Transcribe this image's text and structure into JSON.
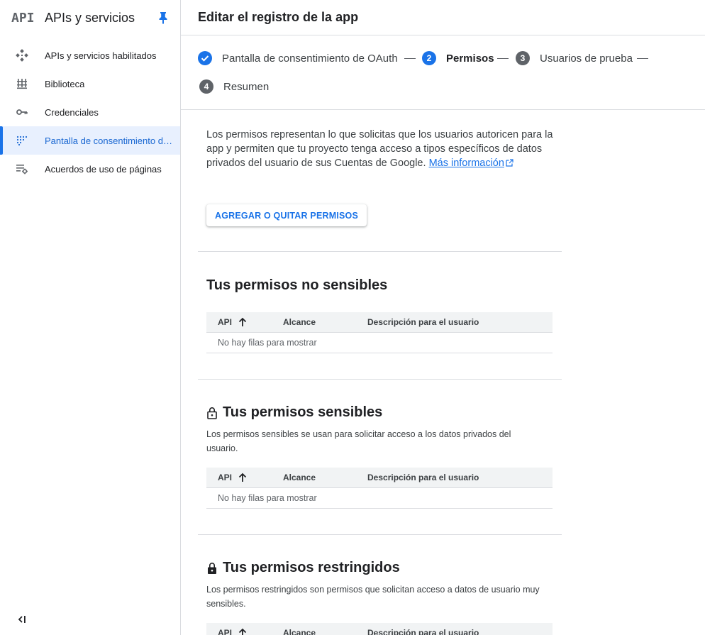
{
  "sidebar": {
    "logo": "API",
    "title": "APIs y servicios",
    "items": [
      {
        "label": "APIs y servicios habilitados",
        "icon": "diamond-nodes-icon"
      },
      {
        "label": "Biblioteca",
        "icon": "library-icon"
      },
      {
        "label": "Credenciales",
        "icon": "key-icon"
      },
      {
        "label": "Pantalla de consentimiento de OAuth",
        "icon": "dots-grid-icon",
        "active": true
      },
      {
        "label": "Acuerdos de uso de páginas",
        "icon": "list-settings-icon"
      }
    ]
  },
  "header": {
    "title": "Editar el registro de la app"
  },
  "stepper": {
    "steps": [
      {
        "number": "",
        "label": "Pantalla de consentimiento de OAuth",
        "state": "done"
      },
      {
        "number": "2",
        "label": "Permisos",
        "state": "current"
      },
      {
        "number": "3",
        "label": "Usuarios de prueba",
        "state": "pending"
      },
      {
        "number": "4",
        "label": "Resumen",
        "state": "pending"
      }
    ]
  },
  "intro": {
    "text": "Los permisos representan lo que solicitas que los usuarios autoricen para la app y permiten que tu proyecto tenga acceso a tipos específicos de datos privados del usuario de sus Cuentas de Google. ",
    "link": "Más información"
  },
  "add_button": "AGREGAR O QUITAR PERMISOS",
  "sections": [
    {
      "title": "Tus permisos no sensibles",
      "description": "",
      "columns": [
        "API",
        "Alcance",
        "Descripción para el usuario"
      ],
      "empty": "No hay filas para mostrar"
    },
    {
      "title": "Tus permisos sensibles",
      "description": "Los permisos sensibles se usan para solicitar acceso a los datos privados del usuario.",
      "columns": [
        "API",
        "Alcance",
        "Descripción para el usuario"
      ],
      "empty": "No hay filas para mostrar"
    },
    {
      "title": "Tus permisos restringidos",
      "description": "Los permisos restringidos son permisos que solicitan acceso a datos de usuario muy sensibles.",
      "columns": [
        "API",
        "Alcance",
        "Descripción para el usuario"
      ],
      "empty": ""
    }
  ],
  "colors": {
    "accent": "#1a73e8",
    "active_bg": "#e8f0fe",
    "step_pending": "#5f6368"
  }
}
